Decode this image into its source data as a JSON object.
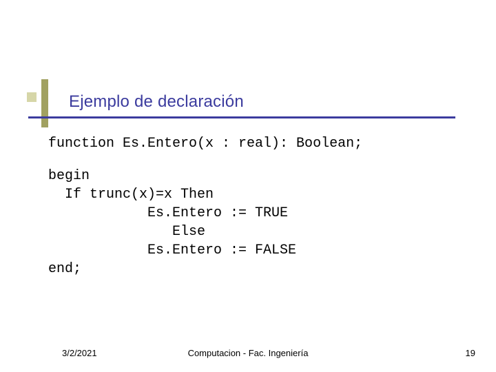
{
  "title": "Ejemplo de declaración",
  "code": {
    "l1": "function Es.Entero(x : real): Boolean;",
    "l2": "begin",
    "l3": "  If trunc(x)=x Then",
    "l4": "            Es.Entero := TRUE",
    "l5": "               Else",
    "l6": "            Es.Entero := FALSE",
    "l7": "end;"
  },
  "footer": {
    "date": "3/2/2021",
    "center": "Computacion  - Fac. Ingeniería",
    "page": "19"
  },
  "colors": {
    "title": "#3b3b9e",
    "rule": "#3b3b9e",
    "accent": "#a1a161",
    "accent_light": "#d6d6a8"
  }
}
